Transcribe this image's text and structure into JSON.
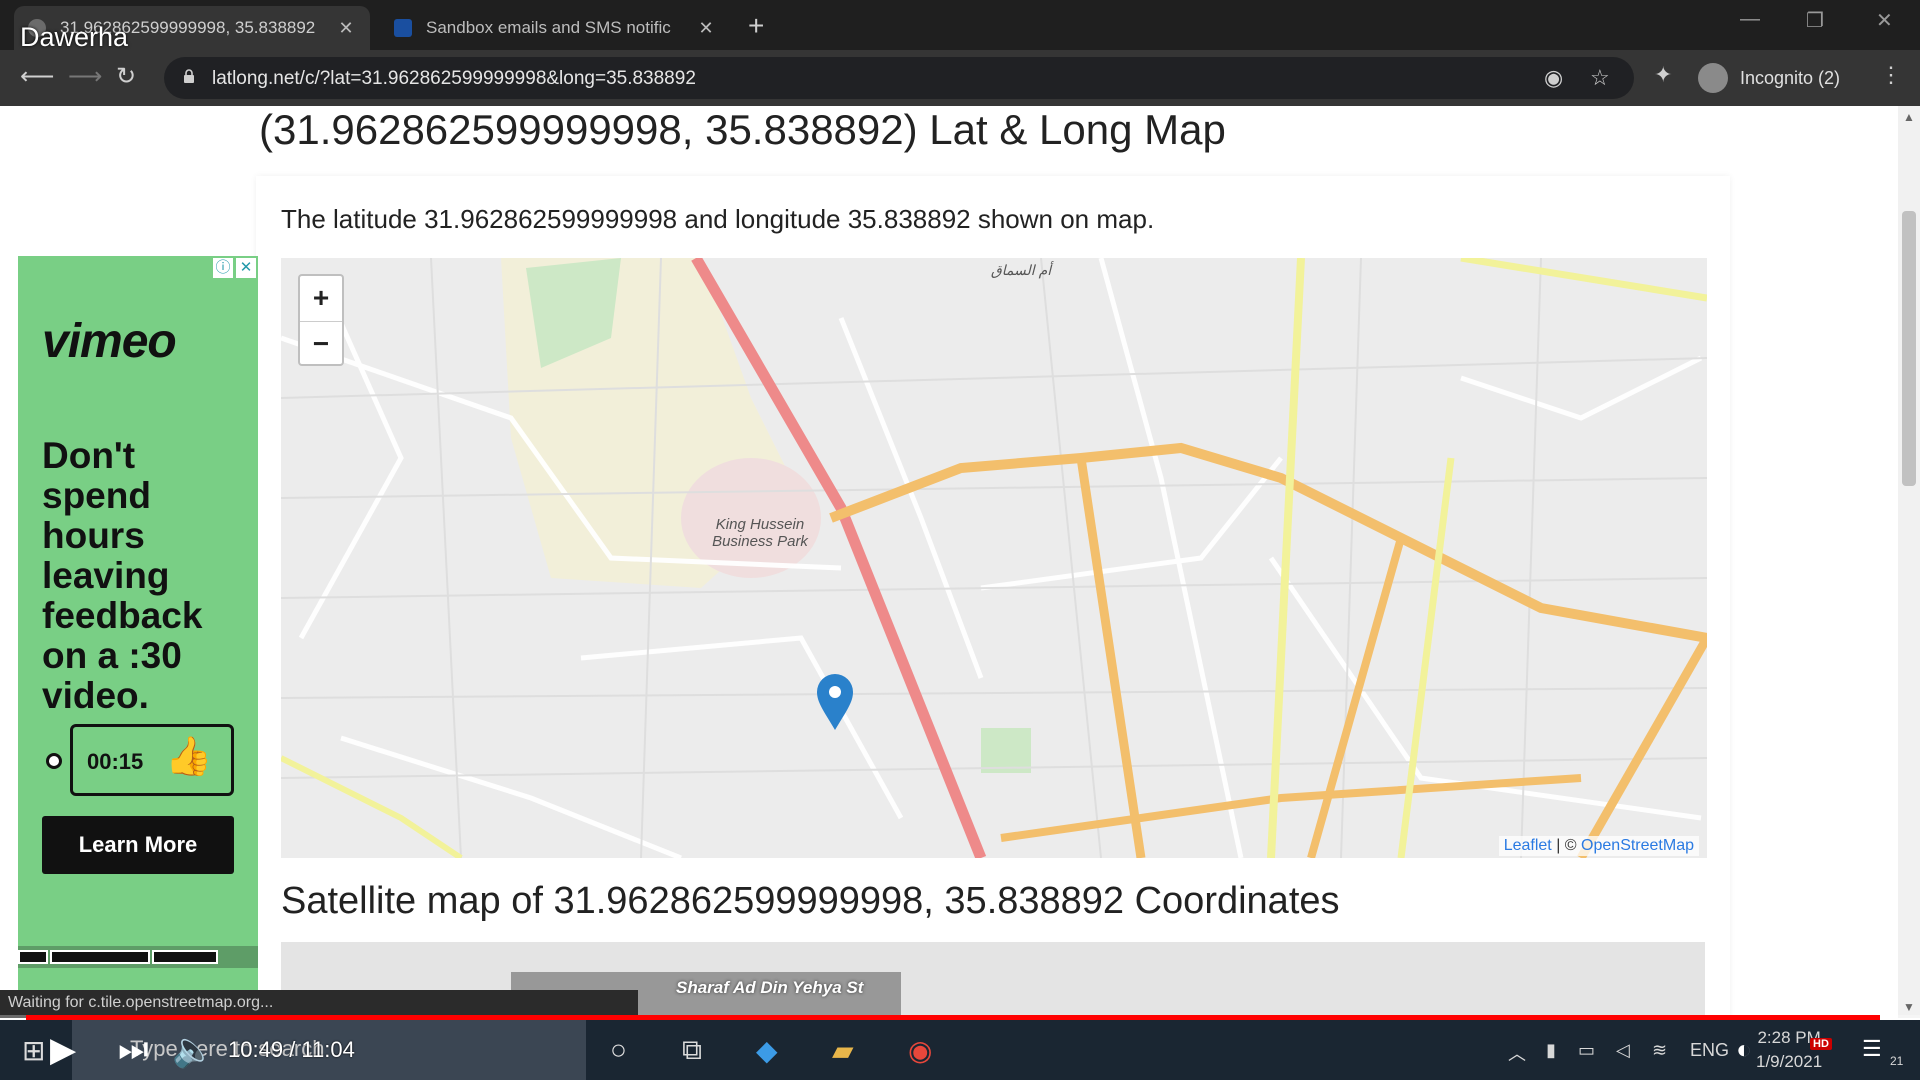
{
  "video_overlay": {
    "channel_name": "Dawerha",
    "current_time": "10:49",
    "duration": "11:04",
    "progress_fraction": 0.986
  },
  "browser": {
    "tabs": [
      {
        "title": "31.962862599999998, 35.838892",
        "active": true
      },
      {
        "title": "Sandbox emails and SMS notific",
        "active": false
      }
    ],
    "url": "latlong.net/c/?lat=31.962862599999998&long=35.838892",
    "profile_label": "Incognito (2)",
    "status_text": "Waiting for c.tile.openstreetmap.org..."
  },
  "page": {
    "heading": "(31.962862599999998, 35.838892) Lat & Long Map",
    "intro": "The latitude 31.962862599999998 and longitude 35.838892 shown on map.",
    "satellite_heading": "Satellite map of 31.962862599999998, 35.838892 Coordinates",
    "satellite_label": "Sharaf Ad Din Yehya St"
  },
  "map": {
    "zoom_in": "+",
    "zoom_out": "−",
    "attribution_leaflet": "Leaflet",
    "attribution_sep": "| ©",
    "attribution_osm": "OpenStreetMap",
    "area_label": "أم السماق",
    "park_label": "King Hussein Business Park",
    "marker_color": "#2a81cb"
  },
  "ad": {
    "brand": "vimeo",
    "copy": "Don't spend hours leaving feedback on a :30 video.",
    "timer": "00:15",
    "cta": "Learn More",
    "background": "#79cf85"
  },
  "taskbar": {
    "search_placeholder": "Type here to search",
    "language": "ENG",
    "time": "2:28 PM",
    "date": "1/9/2021",
    "notification_count": "21",
    "hd_badge": "HD"
  }
}
